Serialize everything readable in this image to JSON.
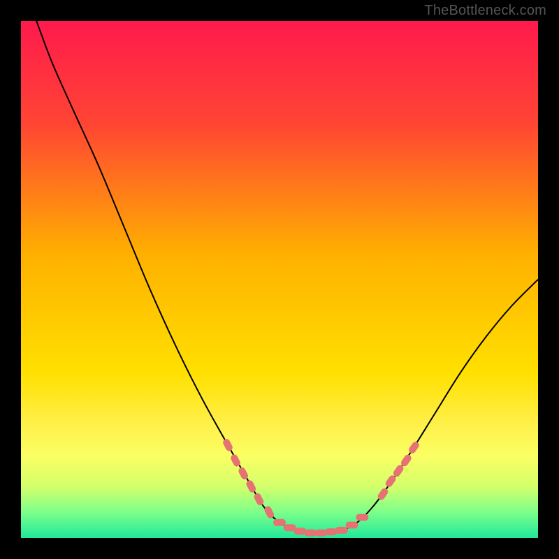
{
  "watermark": "TheBottleneck.com",
  "chart_data": {
    "type": "line",
    "title": "",
    "xlabel": "",
    "ylabel": "",
    "xlim": [
      0,
      100
    ],
    "ylim": [
      0,
      100
    ],
    "background_gradient": {
      "stops": [
        {
          "offset": 0,
          "color": "#ff1a4d"
        },
        {
          "offset": 20,
          "color": "#ff4533"
        },
        {
          "offset": 45,
          "color": "#ffb000"
        },
        {
          "offset": 68,
          "color": "#ffe000"
        },
        {
          "offset": 78,
          "color": "#fff04a"
        },
        {
          "offset": 84,
          "color": "#fbff63"
        },
        {
          "offset": 90,
          "color": "#d4ff6a"
        },
        {
          "offset": 95,
          "color": "#7dff8a"
        },
        {
          "offset": 100,
          "color": "#20e89a"
        }
      ]
    },
    "series": [
      {
        "name": "bottleneck-curve",
        "type": "line",
        "color": "#000000",
        "points": [
          {
            "x": 3,
            "y": 100
          },
          {
            "x": 6,
            "y": 92
          },
          {
            "x": 10,
            "y": 83
          },
          {
            "x": 15,
            "y": 72
          },
          {
            "x": 20,
            "y": 60
          },
          {
            "x": 25,
            "y": 48
          },
          {
            "x": 30,
            "y": 37
          },
          {
            "x": 35,
            "y": 27
          },
          {
            "x": 40,
            "y": 18
          },
          {
            "x": 44,
            "y": 11
          },
          {
            "x": 47,
            "y": 6
          },
          {
            "x": 50,
            "y": 3
          },
          {
            "x": 53,
            "y": 1.5
          },
          {
            "x": 56,
            "y": 1
          },
          {
            "x": 59,
            "y": 1
          },
          {
            "x": 62,
            "y": 1.5
          },
          {
            "x": 65,
            "y": 3
          },
          {
            "x": 68,
            "y": 6
          },
          {
            "x": 71,
            "y": 10
          },
          {
            "x": 75,
            "y": 16
          },
          {
            "x": 80,
            "y": 24
          },
          {
            "x": 85,
            "y": 32
          },
          {
            "x": 90,
            "y": 39
          },
          {
            "x": 95,
            "y": 45
          },
          {
            "x": 100,
            "y": 50
          }
        ]
      },
      {
        "name": "highlight-markers",
        "type": "scatter",
        "color": "#e57373",
        "points": [
          {
            "x": 40,
            "y": 18
          },
          {
            "x": 41.5,
            "y": 15
          },
          {
            "x": 43,
            "y": 12.5
          },
          {
            "x": 44.5,
            "y": 10
          },
          {
            "x": 46,
            "y": 7.5
          },
          {
            "x": 48,
            "y": 5
          },
          {
            "x": 50,
            "y": 3
          },
          {
            "x": 52,
            "y": 2
          },
          {
            "x": 54,
            "y": 1.3
          },
          {
            "x": 56,
            "y": 1
          },
          {
            "x": 58,
            "y": 1
          },
          {
            "x": 60,
            "y": 1.2
          },
          {
            "x": 62,
            "y": 1.5
          },
          {
            "x": 64,
            "y": 2.5
          },
          {
            "x": 66,
            "y": 4
          },
          {
            "x": 70,
            "y": 8.5
          },
          {
            "x": 71.5,
            "y": 11
          },
          {
            "x": 73,
            "y": 13
          },
          {
            "x": 74.5,
            "y": 15
          },
          {
            "x": 76,
            "y": 17.5
          }
        ]
      }
    ]
  }
}
